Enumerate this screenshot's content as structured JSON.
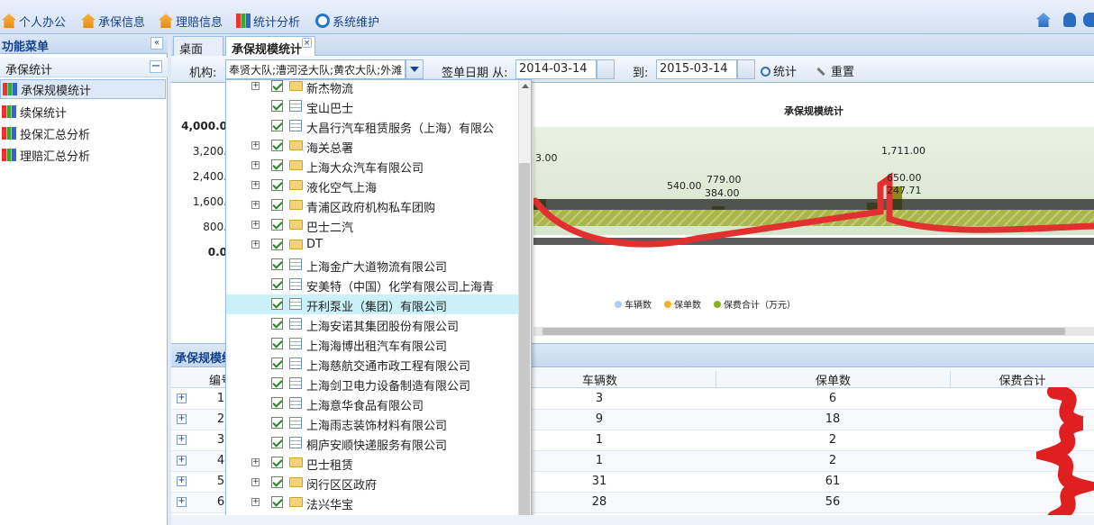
{
  "menu": {
    "items": [
      {
        "label": "个人办公",
        "icon": "house-icon"
      },
      {
        "label": "承保信息",
        "icon": "house-icon"
      },
      {
        "label": "理赔信息",
        "icon": "house-icon"
      },
      {
        "label": "统计分析",
        "icon": "chart-icon"
      },
      {
        "label": "系统维护",
        "icon": "gear-icon"
      }
    ]
  },
  "sidebar": {
    "title": "功能菜单",
    "section": "承保统计",
    "items": [
      {
        "label": "承保规模统计",
        "selected": true
      },
      {
        "label": "续保统计"
      },
      {
        "label": "投保汇总分析"
      },
      {
        "label": "理赔汇总分析"
      }
    ]
  },
  "tabs": [
    {
      "label": "桌面"
    },
    {
      "label": "承保规模统计",
      "active": true
    }
  ],
  "toolbar": {
    "org_label": "机构:",
    "org_value": "奉贤大队;漕河泾大队;黄农大队;外滩",
    "date_label": "签单日期 从:",
    "date_from": "2014-03-14",
    "to_label": "到:",
    "date_to": "2015-03-14",
    "stat_button": "统计",
    "reset_button": "重置"
  },
  "org_tree": [
    {
      "label": "新杰物流",
      "type": "folder",
      "expandable": true
    },
    {
      "label": "宝山巴士",
      "type": "doc"
    },
    {
      "label": "大昌行汽车租赁服务（上海）有限公",
      "type": "doc"
    },
    {
      "label": "海关总署",
      "type": "folder",
      "expandable": true
    },
    {
      "label": "上海大众汽车有限公司",
      "type": "folder",
      "expandable": true
    },
    {
      "label": "液化空气上海",
      "type": "folder",
      "expandable": true
    },
    {
      "label": "青浦区政府机构私车团购",
      "type": "folder",
      "expandable": true
    },
    {
      "label": "巴士二汽",
      "type": "folder",
      "expandable": true
    },
    {
      "label": "DT",
      "type": "folder",
      "expandable": true
    },
    {
      "label": "上海金广大道物流有限公司",
      "type": "doc"
    },
    {
      "label": "安美特（中国）化学有限公司上海青",
      "type": "doc"
    },
    {
      "label": "开利泵业（集团）有限公司",
      "type": "doc",
      "highlighted": true
    },
    {
      "label": "上海安诺其集团股份有限公司",
      "type": "doc"
    },
    {
      "label": "上海海博出租汽车有限公司",
      "type": "doc"
    },
    {
      "label": "上海慈航交通市政工程有限公司",
      "type": "doc"
    },
    {
      "label": "上海剑卫电力设备制造有限公司",
      "type": "doc"
    },
    {
      "label": "上海意华食品有限公司",
      "type": "doc"
    },
    {
      "label": "上海雨志装饰材料有限公司",
      "type": "doc"
    },
    {
      "label": "桐庐安顺快递服务有限公司",
      "type": "doc"
    },
    {
      "label": "巴士租赁",
      "type": "folder",
      "expandable": true
    },
    {
      "label": "闵行区区政府",
      "type": "folder",
      "expandable": true
    },
    {
      "label": "法兴华宝",
      "type": "folder",
      "expandable": true
    }
  ],
  "chart_data": {
    "type": "bar",
    "title": "承保规模统计",
    "y_ticks": [
      "4,000.0",
      "3,200.",
      "2,400.",
      "1,600.",
      "800.",
      "0.0"
    ],
    "ylim": [
      0,
      4000
    ],
    "annotations": [
      "3.00",
      "540.00",
      "779.00",
      "384.00",
      "1,711.00",
      "650.00",
      "247.71"
    ],
    "legend": [
      {
        "name": "车辆数",
        "color": "#a9cdf2"
      },
      {
        "name": "保单数",
        "color": "#f0b428"
      },
      {
        "name": "保费合计（万元）",
        "color": "#8ab21e"
      }
    ],
    "legend_position": "bottom"
  },
  "grid": {
    "title": "承保规模统",
    "columns": [
      "编号",
      "车辆数",
      "保单数",
      "保费合计"
    ],
    "rows": [
      {
        "id": "1",
        "vehicles": "3",
        "policies": "6"
      },
      {
        "id": "2",
        "vehicles": "9",
        "policies": "18"
      },
      {
        "id": "3",
        "vehicles": "1",
        "policies": "2"
      },
      {
        "id": "4",
        "vehicles": "1",
        "policies": "2"
      },
      {
        "id": "5",
        "vehicles": "31",
        "policies": "61"
      },
      {
        "id": "6",
        "vehicles": "28",
        "policies": "56"
      }
    ]
  },
  "colors": {
    "accent": "#15428b",
    "border": "#99bbe8",
    "annotation": "#e23030"
  }
}
